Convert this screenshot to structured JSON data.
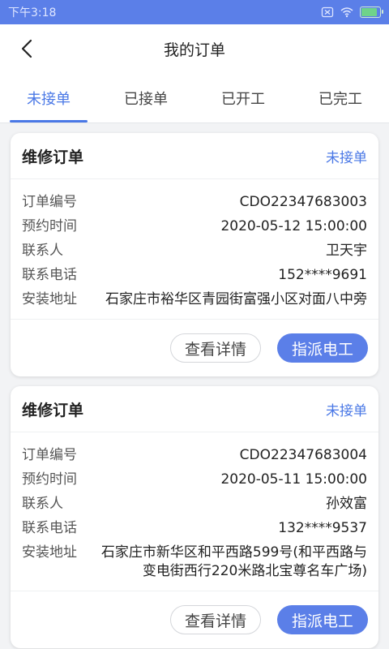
{
  "status_bar": {
    "time": "下午3:18"
  },
  "header": {
    "title": "我的订单"
  },
  "tabs": [
    {
      "label": "未接单"
    },
    {
      "label": "已接单"
    },
    {
      "label": "已开工"
    },
    {
      "label": "已完工"
    }
  ],
  "labels": {
    "order_no": "订单编号",
    "time": "预约时间",
    "contact": "联系人",
    "phone": "联系电话",
    "address": "安装地址"
  },
  "orders": [
    {
      "type": "维修订单",
      "status": "未接单",
      "order_no": "CDO22347683003",
      "time": "2020-05-12 15:00:00",
      "contact": "卫天宇",
      "phone": "152****9691",
      "address": "石家庄市裕华区青园街富强小区对面八中旁",
      "detail_btn": "查看详情",
      "assign_btn": "指派电工"
    },
    {
      "type": "维修订单",
      "status": "未接单",
      "order_no": "CDO22347683004",
      "time": "2020-05-11 15:00:00",
      "contact": "孙效富",
      "phone": "132****9537",
      "address": "石家庄市新华区和平西路599号(和平西路与变电街西行220米路北宝尊名车广场)",
      "detail_btn": "查看详情",
      "assign_btn": "指派电工"
    }
  ],
  "colors": {
    "accent": "#4a78e6",
    "status_bar": "#5b7fe8",
    "background": "#f2f3f5"
  },
  "icons": {
    "back": "chevron-left-icon",
    "signal": "sim-off-icon",
    "wifi": "wifi-icon",
    "battery": "battery-charging-icon"
  },
  "battery_level": 0.8
}
